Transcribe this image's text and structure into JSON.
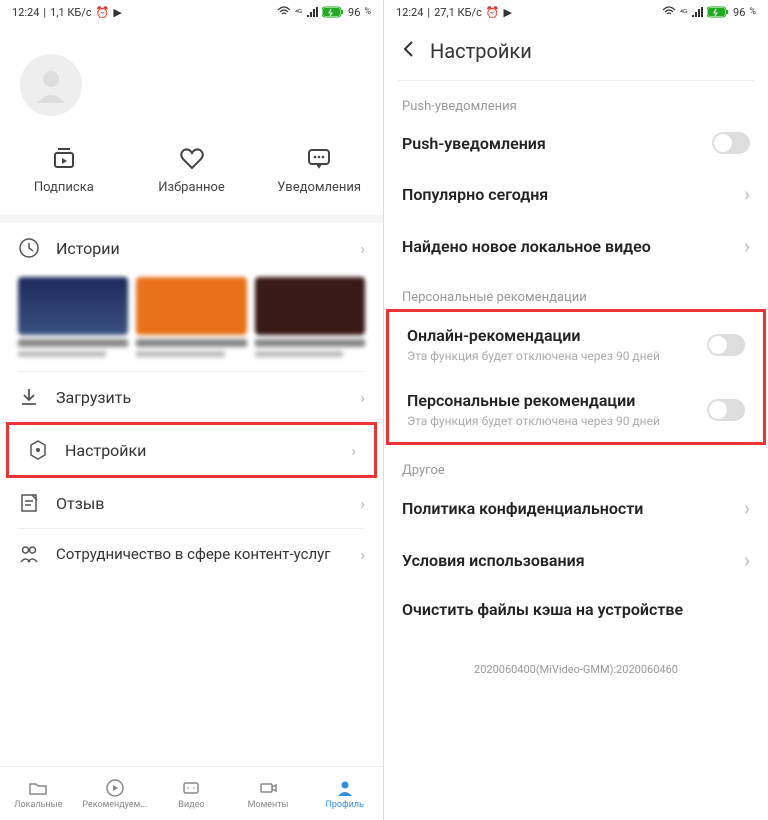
{
  "left": {
    "status": {
      "time": "12:24",
      "speed": "1,1 КБ/с",
      "battery": "96",
      "battery_suffix": "%"
    },
    "actions": {
      "sub": "Подписка",
      "fav": "Избранное",
      "notif": "Уведомления"
    },
    "menu": {
      "history": "Истории",
      "download": "Загрузить",
      "settings": "Настройки",
      "feedback": "Отзыв",
      "partner": "Сотрудничество в сфере контент-услуг"
    },
    "nav": {
      "local": "Локальные",
      "rec": "Рекомендуем...",
      "video": "Видео",
      "moments": "Моменты",
      "profile": "Профиль"
    }
  },
  "right": {
    "status": {
      "time": "12:24",
      "speed": "27,1 КБ/с",
      "battery": "96",
      "battery_suffix": "%"
    },
    "header": "Настройки",
    "sections": {
      "push_label": "Push-уведомления",
      "push_row": "Push-уведомления",
      "popular": "Популярно сегодня",
      "found_local": "Найдено новое локальное видео",
      "personal_label": "Персональные рекомендации",
      "online_rec": "Онлайн-рекомендации",
      "online_rec_sub": "Эта функция будет отключена через 90 дней",
      "personal_rec": "Персональные рекомендации",
      "personal_rec_sub": "Эта функция будет отключена через 90 дней",
      "other_label": "Другое",
      "privacy": "Политика конфиденциальности",
      "terms": "Условия использования",
      "clear_cache": "Очистить файлы кэша на устройстве"
    },
    "version": "2020060400(MiVideo-GMM):2020060460"
  }
}
